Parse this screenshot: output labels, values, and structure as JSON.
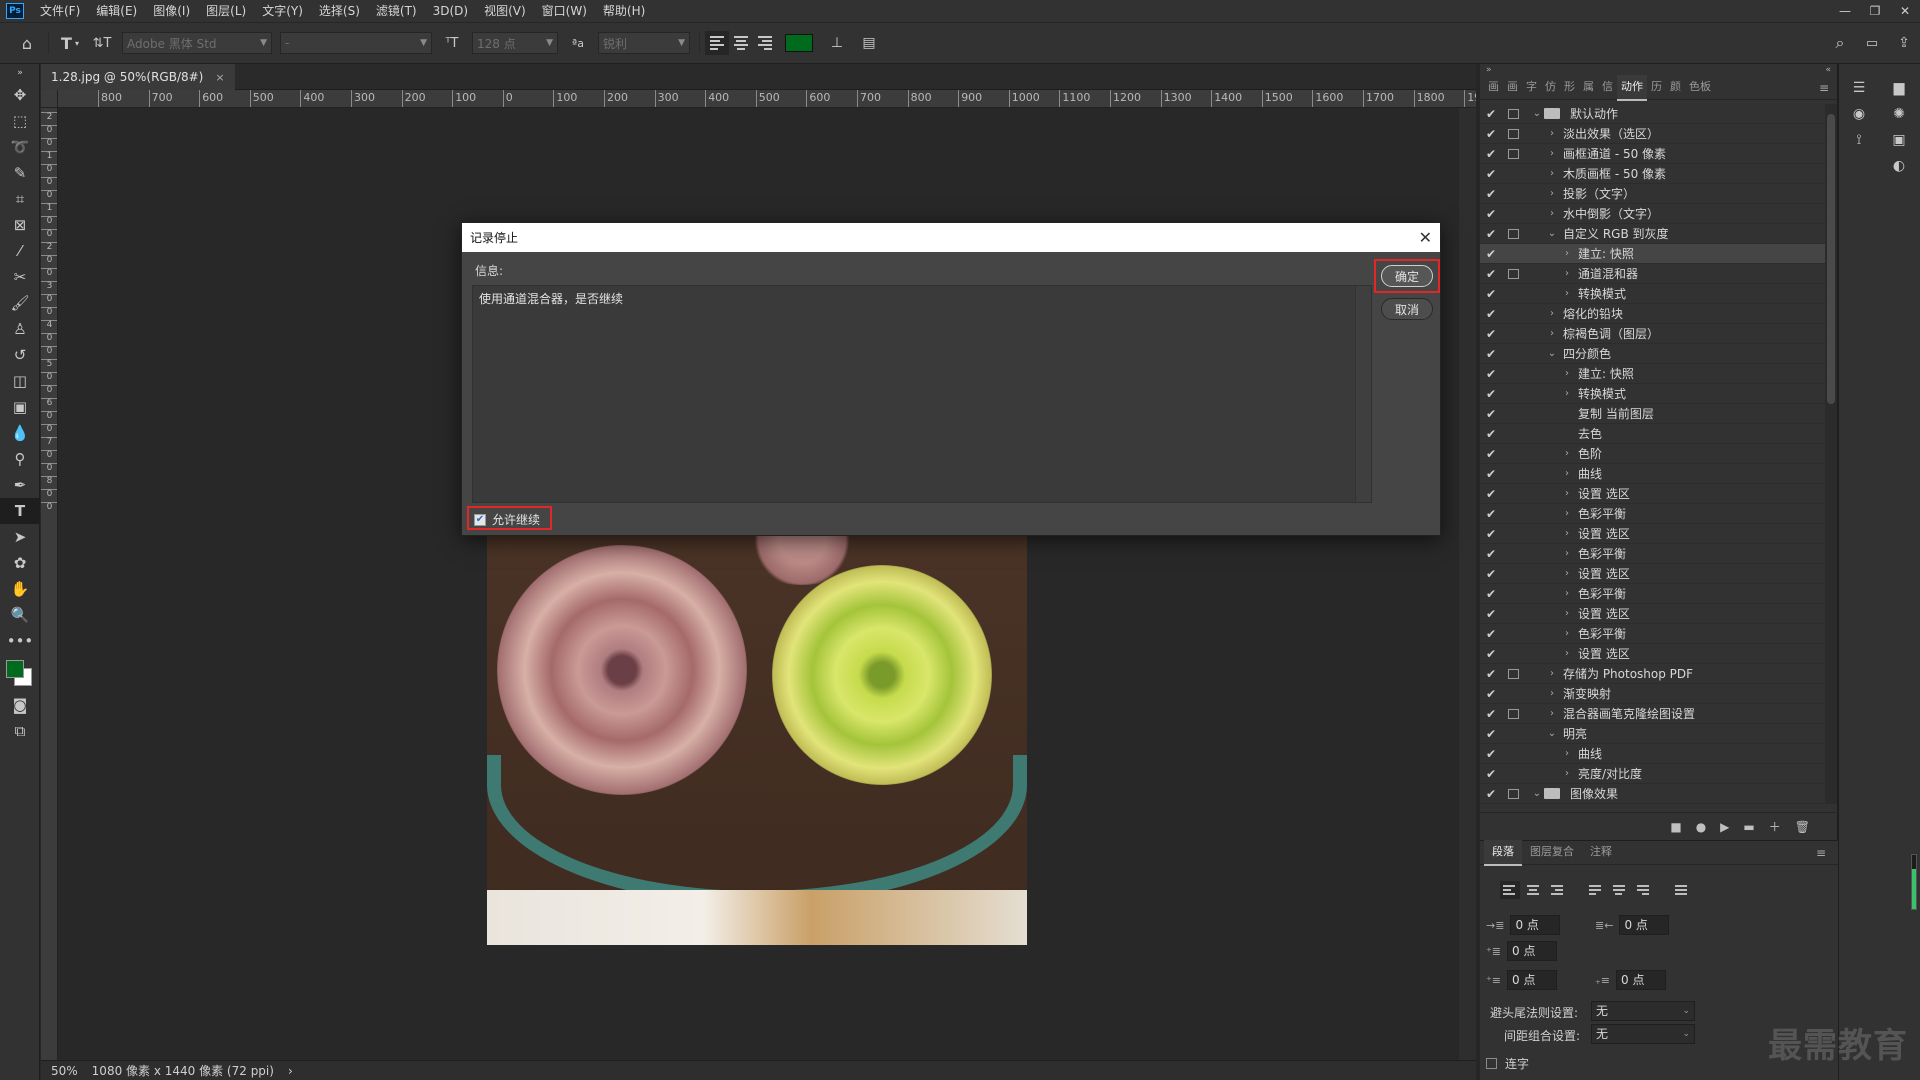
{
  "menu": {
    "logo": "Ps",
    "items": [
      "文件(F)",
      "编辑(E)",
      "图像(I)",
      "图层(L)",
      "文字(Y)",
      "选择(S)",
      "滤镜(T)",
      "3D(D)",
      "视图(V)",
      "窗口(W)",
      "帮助(H)"
    ]
  },
  "options_bar": {
    "font_family": "Adobe 黑体 Std",
    "font_style": "-",
    "font_size": "128 点",
    "antialias": "锐利",
    "text_color": "#006b1c"
  },
  "document": {
    "tab_title": "1.28.jpg @ 50%(RGB/8#)",
    "close": "×"
  },
  "ruler": {
    "h_labels": [
      "800",
      "700",
      "600",
      "500",
      "400",
      "300",
      "200",
      "100",
      "0",
      "100",
      "200",
      "300",
      "400",
      "500",
      "600",
      "700",
      "800",
      "900",
      "1000",
      "1100",
      "1200",
      "1300",
      "1400",
      "1500",
      "1600",
      "1700",
      "1800",
      "190"
    ],
    "v_labels": [
      "2",
      "0",
      "0",
      "1",
      "0",
      "0",
      "0",
      "1",
      "0",
      "0",
      "2",
      "0",
      "0",
      "3",
      "0",
      "0",
      "4",
      "0",
      "0",
      "5",
      "0",
      "0",
      "6",
      "0",
      "0",
      "7",
      "0",
      "0",
      "8",
      "0",
      "0"
    ]
  },
  "dialog": {
    "title": "记录停止",
    "close": "✕",
    "info_label": "信息:",
    "message": "使用通道混合器，是否继续",
    "ok": "确定",
    "cancel": "取消",
    "allow_continue": "允许继续"
  },
  "actions_panel": {
    "tabs": [
      "画",
      "画",
      "字",
      "仿",
      "形",
      "属",
      "信",
      "动作",
      "历",
      "颜",
      "色板"
    ],
    "active_tab": "动作",
    "rows": [
      {
        "label": "默认动作",
        "level": 0,
        "folder": true,
        "arrow": "⌄",
        "dlg": true
      },
      {
        "label": "淡出效果（选区）",
        "level": 1,
        "arrow": "›",
        "dlg": true
      },
      {
        "label": "画框通道 - 50 像素",
        "level": 1,
        "arrow": "›",
        "dlg": true
      },
      {
        "label": "木质画框 - 50 像素",
        "level": 1,
        "arrow": "›",
        "dlg": false
      },
      {
        "label": "投影（文字）",
        "level": 1,
        "arrow": "›",
        "dlg": false
      },
      {
        "label": "水中倒影（文字）",
        "level": 1,
        "arrow": "›",
        "dlg": false
      },
      {
        "label": "自定义 RGB 到灰度",
        "level": 1,
        "arrow": "⌄",
        "dlg": true
      },
      {
        "label": "建立: 快照",
        "level": 2,
        "arrow": "›",
        "dlg": false,
        "selected": true
      },
      {
        "label": "通道混和器",
        "level": 2,
        "arrow": "›",
        "dlg": true
      },
      {
        "label": "转换模式",
        "level": 2,
        "arrow": "›",
        "dlg": false
      },
      {
        "label": "熔化的铅块",
        "level": 1,
        "arrow": "›",
        "dlg": false
      },
      {
        "label": "棕褐色调（图层）",
        "level": 1,
        "arrow": "›",
        "dlg": false
      },
      {
        "label": "四分颜色",
        "level": 1,
        "arrow": "⌄",
        "dlg": false
      },
      {
        "label": "建立: 快照",
        "level": 2,
        "arrow": "›",
        "dlg": false
      },
      {
        "label": "转换模式",
        "level": 2,
        "arrow": "›",
        "dlg": false
      },
      {
        "label": "复制 当前图层",
        "level": 2,
        "arrow": "",
        "dlg": false
      },
      {
        "label": "去色",
        "level": 2,
        "arrow": "",
        "dlg": false
      },
      {
        "label": "色阶",
        "level": 2,
        "arrow": "›",
        "dlg": false
      },
      {
        "label": "曲线",
        "level": 2,
        "arrow": "›",
        "dlg": false
      },
      {
        "label": "设置 选区",
        "level": 2,
        "arrow": "›",
        "dlg": false
      },
      {
        "label": "色彩平衡",
        "level": 2,
        "arrow": "›",
        "dlg": false
      },
      {
        "label": "设置 选区",
        "level": 2,
        "arrow": "›",
        "dlg": false
      },
      {
        "label": "色彩平衡",
        "level": 2,
        "arrow": "›",
        "dlg": false
      },
      {
        "label": "设置 选区",
        "level": 2,
        "arrow": "›",
        "dlg": false
      },
      {
        "label": "色彩平衡",
        "level": 2,
        "arrow": "›",
        "dlg": false
      },
      {
        "label": "设置 选区",
        "level": 2,
        "arrow": "›",
        "dlg": false
      },
      {
        "label": "色彩平衡",
        "level": 2,
        "arrow": "›",
        "dlg": false
      },
      {
        "label": "设置 选区",
        "level": 2,
        "arrow": "›",
        "dlg": false
      },
      {
        "label": "存储为 Photoshop PDF",
        "level": 1,
        "arrow": "›",
        "dlg": true
      },
      {
        "label": "渐变映射",
        "level": 1,
        "arrow": "›",
        "dlg": false
      },
      {
        "label": "混合器画笔克隆绘图设置",
        "level": 1,
        "arrow": "›",
        "dlg": true
      },
      {
        "label": "明亮",
        "level": 1,
        "arrow": "⌄",
        "dlg": false
      },
      {
        "label": "曲线",
        "level": 2,
        "arrow": "›",
        "dlg": false
      },
      {
        "label": "亮度/对比度",
        "level": 2,
        "arrow": "›",
        "dlg": false
      },
      {
        "label": "图像效果",
        "level": 0,
        "folder": true,
        "arrow": "⌄",
        "dlg": true
      }
    ],
    "footer_icons": [
      "■",
      "●",
      "▶",
      "▬",
      "＋",
      "🗑"
    ]
  },
  "paragraph_panel": {
    "tabs": [
      "段落",
      "图层复合",
      "注释"
    ],
    "active_tab": "段落",
    "indent_left": "0 点",
    "indent_right": "0 点",
    "indent_first": "0 点",
    "space_before": "0 点",
    "space_after": "0 点",
    "kinsoku_label": "避头尾法则设置:",
    "kinsoku_value": "无",
    "mojikumi_label": "间距组合设置:",
    "mojikumi_value": "无",
    "hyphenate_label": "连字"
  },
  "status": {
    "zoom": "50%",
    "size": "1080 像素 x 1440 像素 (72 ppi)",
    "more": "›"
  },
  "watermark": "最需教育",
  "colors": {
    "foreground": "#006b1c",
    "background": "#ffffff",
    "highlight": "#e32626"
  }
}
